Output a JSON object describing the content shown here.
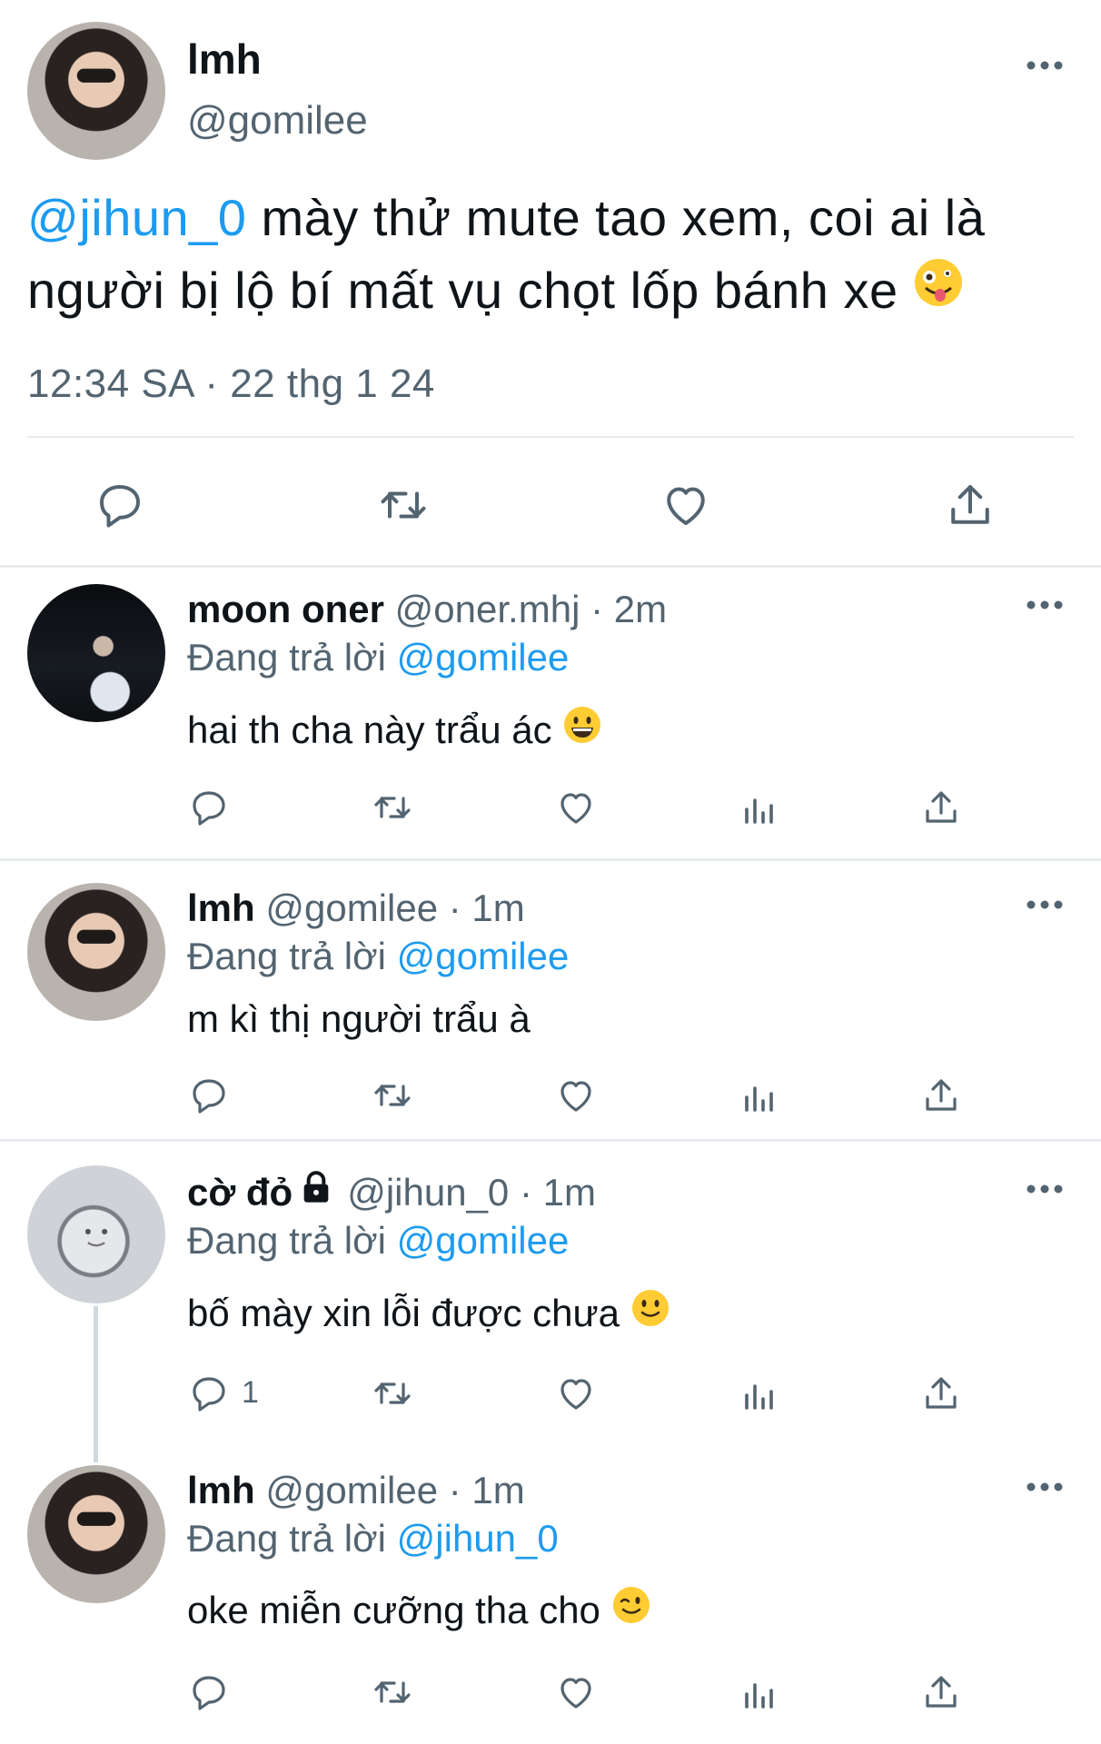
{
  "main_tweet": {
    "name": "lmh",
    "handle": "@gomilee",
    "mention": "@jihun_0",
    "text_line1": " mày thử mute tao xem, coi ai là",
    "text_line2": "người bị lộ bí mất vụ chọt lốp bánh xe ",
    "emoji": "zany-face-emoji",
    "timestamp": "12:34 SA · 22 thg 1 24",
    "actions": [
      "reply-icon",
      "retweet-icon",
      "like-icon",
      "share-icon"
    ]
  },
  "replies": [
    {
      "name": "moon oner",
      "meta": " @oner.mhj · 2m",
      "replying_prefix": "Đang trả lời ",
      "replying_to": "@gomilee",
      "text": "hai th cha này trẩu ác ",
      "emoji": "grinning-face-emoji",
      "locked": false,
      "reply_count": ""
    },
    {
      "name": "lmh",
      "meta": " @gomilee · 1m",
      "replying_prefix": "Đang trả lời ",
      "replying_to": "@gomilee",
      "text": "m kì thị người trẩu à",
      "emoji": "",
      "locked": false,
      "reply_count": ""
    },
    {
      "name": "cờ đỏ",
      "meta": "@jihun_0 · 1m",
      "replying_prefix": "Đang trả lời ",
      "replying_to": "@gomilee",
      "text": "bố mày xin lỗi được chưa ",
      "emoji": "slightly-smiling-face-emoji",
      "locked": true,
      "reply_count": "1"
    },
    {
      "name": "lmh",
      "meta": " @gomilee · 1m",
      "replying_prefix": "Đang trả lời ",
      "replying_to": "@jihun_0",
      "text": "oke miễn cưỡng tha cho ",
      "emoji": "winking-face-emoji",
      "locked": false,
      "reply_count": ""
    }
  ],
  "colors": {
    "accent": "#1d9bf0",
    "secondary_text": "#536471",
    "icon": "#536471",
    "divider": "#e7ebee",
    "emoji_yellow": "#ffcc33"
  }
}
